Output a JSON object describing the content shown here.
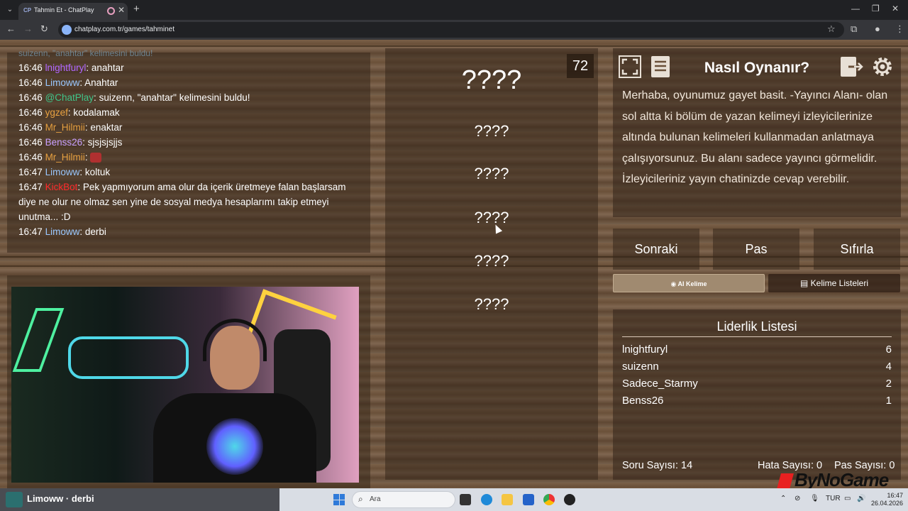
{
  "browser": {
    "tab_title": "Tahmin Et - ChatPlay",
    "tab_favicon": "CP",
    "url": "chatplay.com.tr/games/tahminet"
  },
  "chat": {
    "partial_top": "suizenn, \"anahtar\" kelimesini buldu!",
    "messages": [
      {
        "time": "16:46",
        "user": "lnightfuryl",
        "color": "purple",
        "text": "anahtar"
      },
      {
        "time": "16:46",
        "user": "Limoww",
        "color": "blue",
        "text": "Anahtar"
      },
      {
        "time": "16:46",
        "user": "@ChatPlay",
        "color": "green",
        "text": "suizenn, \"anahtar\" kelimesini buldu!"
      },
      {
        "time": "16:46",
        "user": "ygzef",
        "color": "orange",
        "text": "kodalamak"
      },
      {
        "time": "16:46",
        "user": "Mr_Hilmii",
        "color": "orange",
        "text": "enaktar"
      },
      {
        "time": "16:46",
        "user": "Benss26",
        "color": "lav",
        "text": "sjsjsjsjjs"
      },
      {
        "time": "16:46",
        "user": "Mr_Hilmii",
        "color": "orange",
        "text": ""
      },
      {
        "time": "16:47",
        "user": "Limoww",
        "color": "blue",
        "text": "koltuk"
      },
      {
        "time": "16:47",
        "user": "KickBot",
        "color": "red",
        "text": "Pek yapmıyorum ama olur da içerik üretmeye falan başlarsam diye ne olur ne olmaz sen yine de sosyal medya hesaplarımı takip etmeyi unutma... :D"
      },
      {
        "time": "16:47",
        "user": "Limoww",
        "color": "blue",
        "text": "derbi"
      }
    ]
  },
  "game": {
    "timer": "72",
    "main_word": "????",
    "banned_words": [
      "????",
      "????",
      "????",
      "????",
      "????"
    ]
  },
  "help": {
    "title": "Nasıl Oynanır?",
    "text": "Merhaba, oyunumuz gayet basit. -Yayıncı Alanı- olan sol altta ki bölüm de yazan kelimeyi izleyicilerinize altında bulunan kelimeleri kullanmadan anlatmaya çalışıyorsunuz. Bu alanı sadece yayıncı görmelidir. İzleyicileriniz yayın chatinizde cevap verebilir."
  },
  "buttons": {
    "next": "Sonraki",
    "pass": "Pas",
    "reset": "Sıfırla",
    "ai_word": "AI Kelime",
    "word_lists": "Kelime Listeleri"
  },
  "leaderboard": {
    "title": "Liderlik Listesi",
    "rows": [
      {
        "name": "lnightfuryl",
        "score": "6"
      },
      {
        "name": "suizenn",
        "score": "4"
      },
      {
        "name": "Sadece_Starmy",
        "score": "2"
      },
      {
        "name": "Benss26",
        "score": "1"
      }
    ],
    "question_count": "Soru Sayısı: 14",
    "error_count": "Hata Sayısı: 0",
    "pass_count": "Pas Sayısı: 0"
  },
  "watermark": "ByNoGame",
  "taskbar": {
    "media_label": "Limoww · derbi",
    "search_placeholder": "Ara",
    "lang": "TUR",
    "time": "16:47",
    "date": "26.04.2026"
  }
}
